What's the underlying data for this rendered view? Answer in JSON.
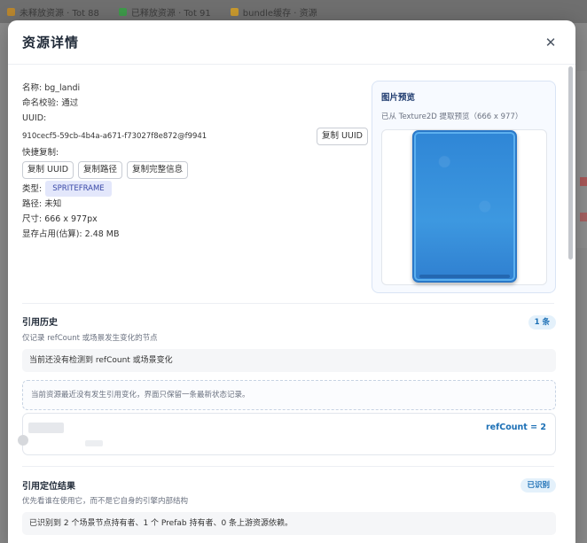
{
  "background": {
    "tabs": [
      "未释放资源 · Tot 88",
      "已释放资源 · Tot 91",
      "bundle缓存 · 资源"
    ]
  },
  "modal": {
    "title": "资源详情",
    "close_symbol": "✕"
  },
  "info": {
    "name": "名称: bg_landi",
    "name_check": "命名校验: 通过",
    "uuid_label": "UUID:",
    "uuid_value": "910cecf5-59cb-4b4a-a671-f73027f8e872@f9941",
    "copy_uuid_top": "复制 UUID",
    "quick_copy_label": "快捷复制:",
    "quick_buttons": [
      "复制 UUID",
      "复制路径",
      "复制完整信息"
    ],
    "type_label": "类型:",
    "type_value": "SPRITEFRAME",
    "path": "路径: 未知",
    "size": "尺寸: 666 x 977px",
    "memory": "显存占用(估算): 2.48 MB"
  },
  "preview": {
    "title": "图片预览",
    "subtitle": "已从 Texture2D 提取预览（666 x 977）"
  },
  "ref_history": {
    "title": "引用历史",
    "subtitle": "仅记录 refCount 或场景发生变化的节点",
    "badge": "1 条",
    "note": "当前还没有检测到 refCount 或场景变化",
    "dashed_note": "当前资源最近没有发生引用变化，界面只保留一条最新状态记录。",
    "refcount": "refCount = 2"
  },
  "ref_locate": {
    "title": "引用定位结果",
    "subtitle": "优先看谁在使用它，而不是它自身的引擎内部结构",
    "badge": "已识别",
    "note": "已识别到 2 个场景节点持有者、1 个 Prefab 持有者、0 条上游资源依赖。"
  },
  "colors": {
    "accent": "#1b6fb5",
    "type_badge_bg": "#e3e7fb",
    "preview_blue": "#2f86d6"
  }
}
